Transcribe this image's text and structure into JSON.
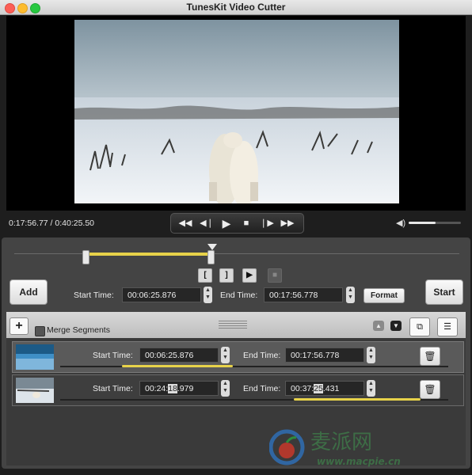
{
  "window": {
    "title": "TunesKit Video Cutter"
  },
  "player": {
    "time_display": "0:17:56.77 / 0:40:25.50",
    "volume_level": 0.52
  },
  "trim": {
    "start_label": "Start Time:",
    "start_value": "00:06:25.876",
    "end_label": "End Time:",
    "end_value": "00:17:56.778",
    "selection_start_fraction": 0.159,
    "selection_end_fraction": 0.444
  },
  "buttons": {
    "add": "Add",
    "start": "Start",
    "format": "Format"
  },
  "segments_header": {
    "merge_label": "Merge Segments"
  },
  "segments": [
    {
      "start_label": "Start Time:",
      "start_value": "00:06:25.876",
      "end_label": "End Time:",
      "end_value": "00:17:56.778",
      "range_start": 0.159,
      "range_end": 0.444
    },
    {
      "start_label": "Start Time:",
      "start_pre": "00:24:",
      "start_sel": "18",
      "start_post": ".979",
      "end_label": "End Time:",
      "end_pre": "00:37:",
      "end_sel": "25",
      "end_post": ".431",
      "range_start": 0.602,
      "range_end": 0.928
    }
  ],
  "watermark": {
    "text": "麦派网",
    "url": "www.macpie.cn"
  },
  "colors": {
    "accent_yellow": "#e7d24a",
    "background": "#1e1e1e",
    "panel": "#444444"
  },
  "icons": [
    "skip-back-icon",
    "step-back-icon",
    "play-icon",
    "stop-icon",
    "step-forward-icon",
    "skip-forward-icon",
    "volume-icon",
    "mark-in-icon",
    "mark-out-icon",
    "preview-icon",
    "record-icon",
    "plus-icon",
    "move-up-icon",
    "move-down-icon",
    "folder-icon",
    "list-icon",
    "trash-icon"
  ]
}
